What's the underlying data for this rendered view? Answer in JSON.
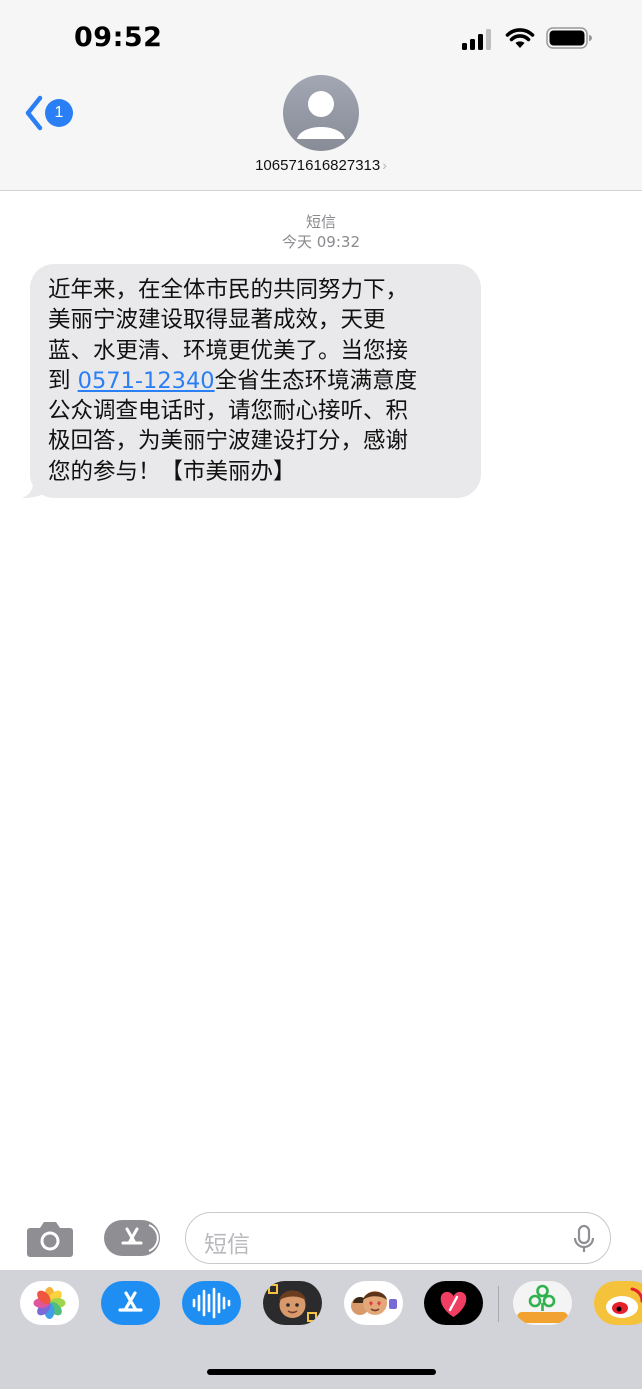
{
  "status_bar": {
    "time": "09:52"
  },
  "header": {
    "back_badge_count": "1",
    "contact_number": "106571616827313",
    "chevron": "›"
  },
  "conversation": {
    "service_label": "短信",
    "timestamp": "今天 09:32",
    "message": {
      "line1": "近年来，在全体市民的共同努力下，",
      "line2": "美丽宁波建设取得显著成效，天更",
      "line3": "蓝、水更清、环境更优美了。当您接",
      "line4_prefix": "到 ",
      "line4_link": "0571-12340",
      "line4_suffix": "全省生态环境满意度",
      "line5": "公众调查电话时，请您耐心接听、积",
      "line6": "极回答，为美丽宁波建设打分，感谢",
      "line7": "您的参与！【市美丽办】"
    }
  },
  "compose": {
    "placeholder": "短信"
  },
  "icons": {
    "camera": "camera-icon",
    "app_store": "app-store-icon",
    "mic": "microphone-icon",
    "apps": [
      "photos-app-icon",
      "app-store-app-icon",
      "audio-message-icon",
      "memoji-icon",
      "memoji-stickers-icon",
      "digital-touch-icon",
      "sina-news-app-icon",
      "weibo-app-icon"
    ]
  },
  "colors": {
    "accent": "#2a7ff5",
    "bubble": "#e9e9eb",
    "header_bg": "#f6f6f6",
    "drawer_bg": "#d1d3d9"
  }
}
